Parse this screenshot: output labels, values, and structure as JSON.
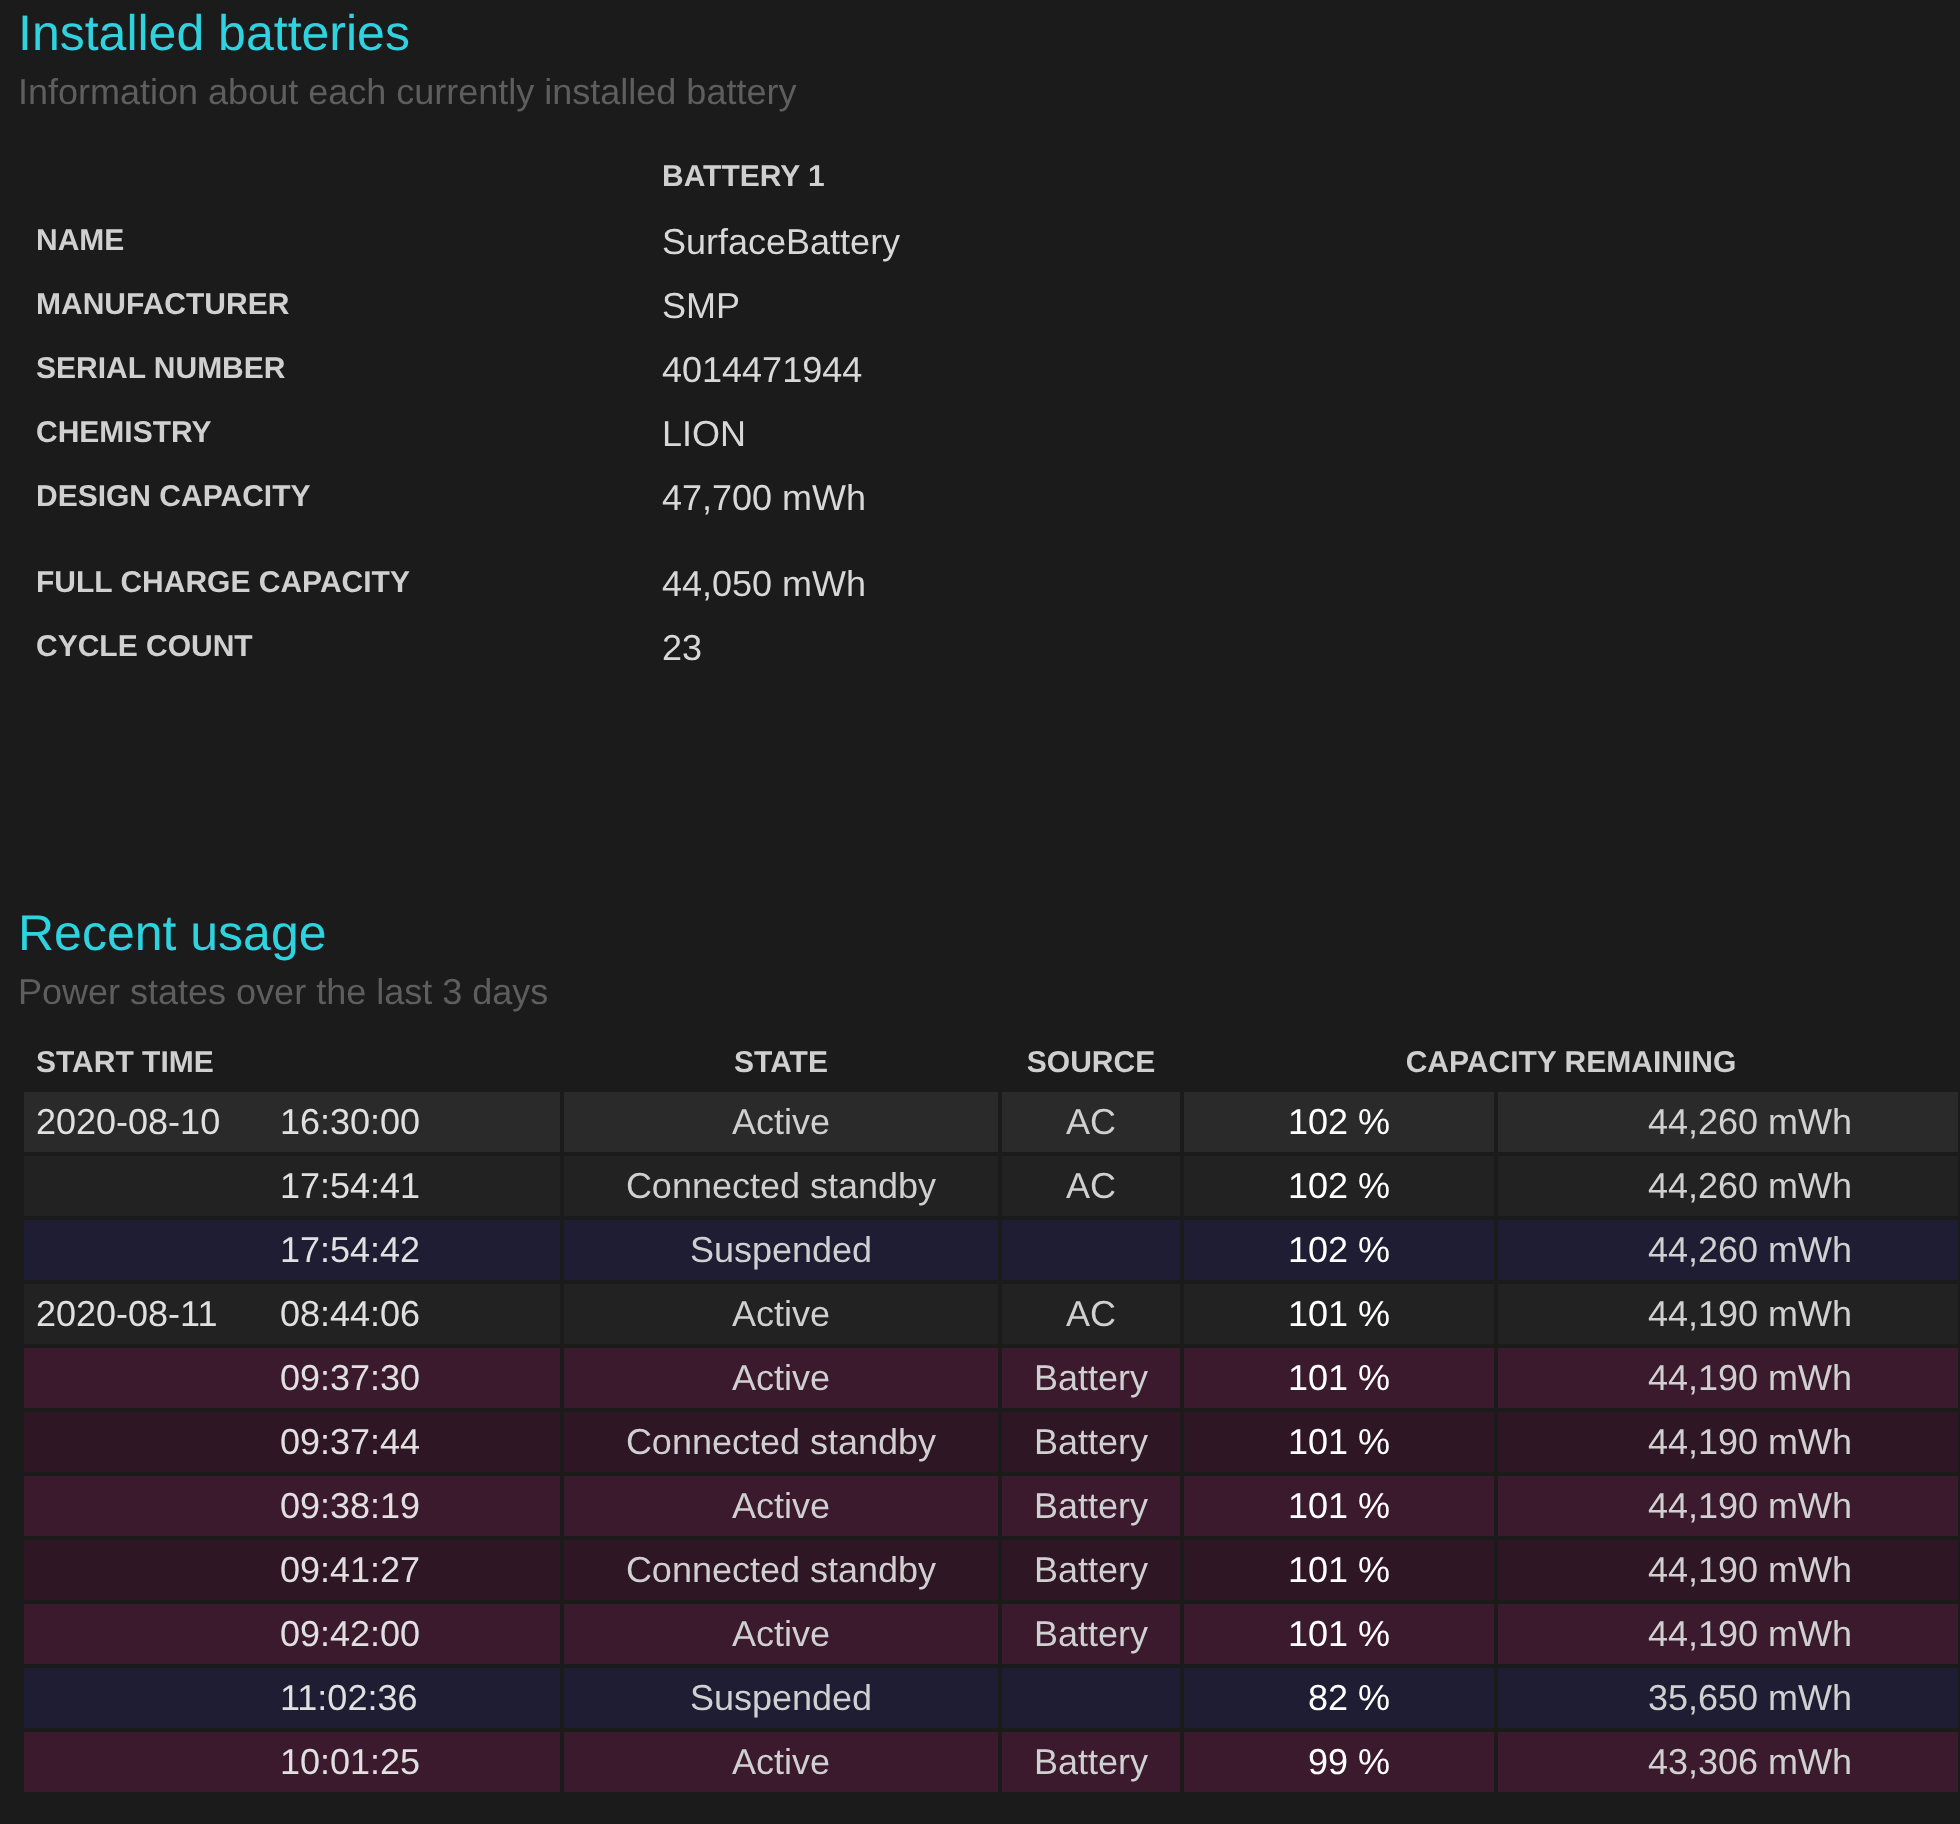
{
  "installed": {
    "title": "Installed batteries",
    "subtitle": "Information about each currently installed battery",
    "column": "BATTERY 1",
    "field_groups": [
      [
        {
          "label": "NAME",
          "value": "SurfaceBattery"
        },
        {
          "label": "MANUFACTURER",
          "value": "SMP"
        },
        {
          "label": "SERIAL NUMBER",
          "value": "4014471944"
        },
        {
          "label": "CHEMISTRY",
          "value": "LION"
        },
        {
          "label": "DESIGN CAPACITY",
          "value": "47,700 mWh"
        }
      ],
      [
        {
          "label": "FULL CHARGE CAPACITY",
          "value": "44,050 mWh"
        },
        {
          "label": "CYCLE COUNT",
          "value": "23"
        }
      ]
    ]
  },
  "recent": {
    "title": "Recent usage",
    "subtitle": "Power states over the last 3 days",
    "columns": [
      "START TIME",
      "STATE",
      "SOURCE",
      "CAPACITY REMAINING"
    ],
    "rows": [
      {
        "kind": "ac",
        "date": "2020-08-10",
        "time": "16:30:00",
        "state": "Active",
        "source": "AC",
        "percent": "102 %",
        "energy": "44,260 mWh"
      },
      {
        "kind": "ac",
        "time": "17:54:41",
        "state": "Connected standby",
        "source": "AC",
        "percent": "102 %",
        "energy": "44,260 mWh"
      },
      {
        "kind": "suspended",
        "time": "17:54:42",
        "state": "Suspended",
        "percent": "102 %",
        "energy": "44,260 mWh"
      },
      {
        "kind": "ac",
        "date": "2020-08-11",
        "time": "08:44:06",
        "state": "Active",
        "source": "AC",
        "percent": "101 %",
        "energy": "44,190 mWh"
      },
      {
        "kind": "battery",
        "time": "09:37:30",
        "state": "Active",
        "source": "Battery",
        "percent": "101 %",
        "energy": "44,190 mWh"
      },
      {
        "kind": "battery",
        "time": "09:37:44",
        "state": "Connected standby",
        "source": "Battery",
        "percent": "101 %",
        "energy": "44,190 mWh"
      },
      {
        "kind": "battery",
        "time": "09:38:19",
        "state": "Active",
        "source": "Battery",
        "percent": "101 %",
        "energy": "44,190 mWh"
      },
      {
        "kind": "battery",
        "time": "09:41:27",
        "state": "Connected standby",
        "source": "Battery",
        "percent": "101 %",
        "energy": "44,190 mWh"
      },
      {
        "kind": "battery",
        "time": "09:42:00",
        "state": "Active",
        "source": "Battery",
        "percent": "101 %",
        "energy": "44,190 mWh"
      },
      {
        "kind": "suspended",
        "time": "11:02:36",
        "state": "Suspended",
        "percent": "82 %",
        "energy": "35,650 mWh"
      },
      {
        "kind": "battery",
        "time": "10:01:25",
        "state": "Active",
        "source": "Battery",
        "percent": "99 %",
        "energy": "43,306 mWh"
      }
    ]
  }
}
